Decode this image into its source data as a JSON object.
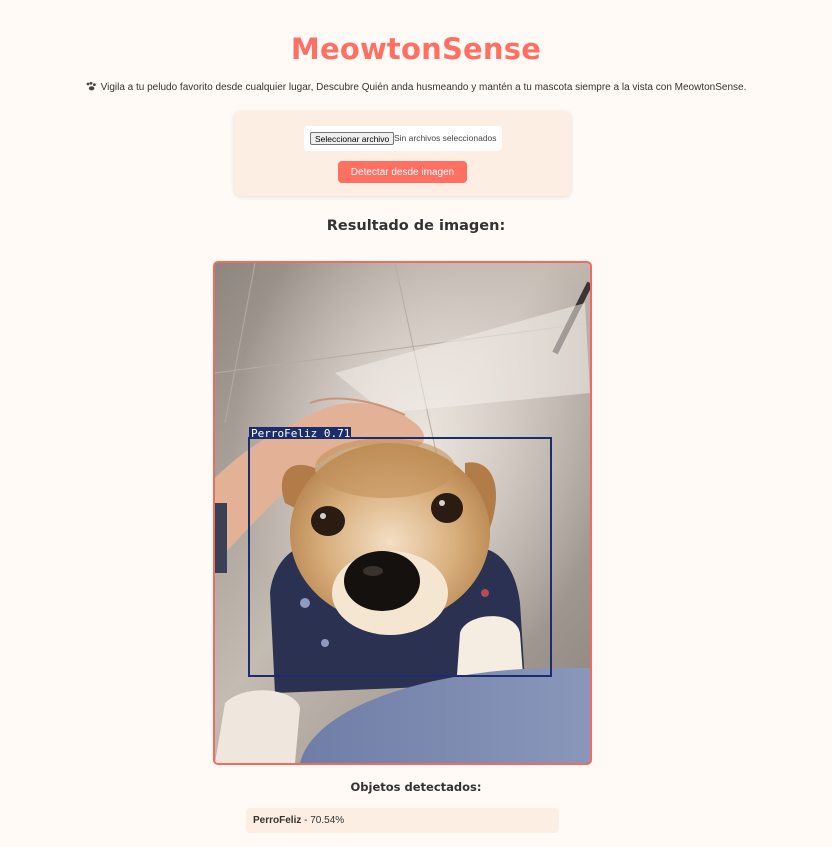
{
  "header": {
    "title": "MeowtonSense",
    "subtitle": "Vigila a tu peludo favorito desde cualquier lugar, Descubre Quién anda husmeando y mantén a tu mascota siempre a la vista con MeowtonSense.",
    "subtitle_icon": "paw-icon"
  },
  "upload": {
    "choose_button_label": "Seleccionar archivo",
    "file_status": "Sin archivos seleccionados",
    "detect_button_label": "Detectar desde imagen"
  },
  "result": {
    "heading": "Resultado de imagen:",
    "bbox_label": "PerroFeliz 0.71"
  },
  "detections": {
    "heading": "Objetos detectados:",
    "items": [
      {
        "label": "PerroFeliz",
        "separator": " - ",
        "confidence": "70.54%"
      }
    ]
  },
  "colors": {
    "accent": "#ff7063",
    "background": "#fffaf5",
    "card": "#fdeee4",
    "bbox": "#1c2d6e"
  }
}
